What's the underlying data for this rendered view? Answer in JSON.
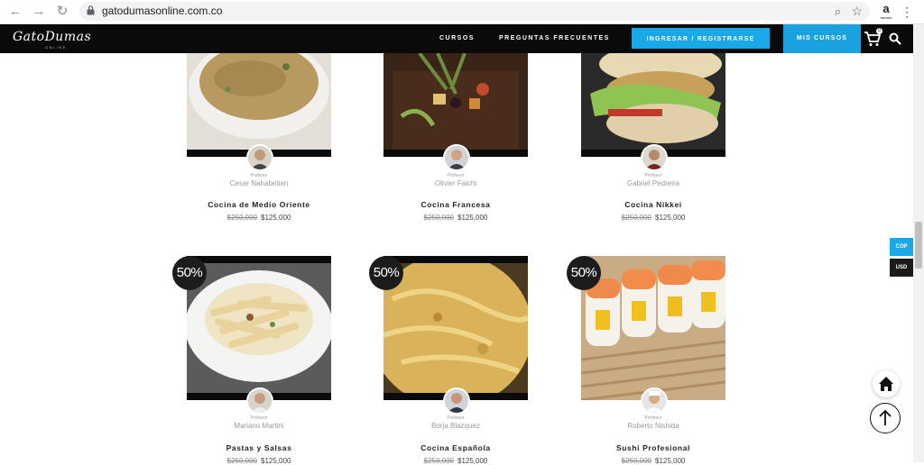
{
  "browser": {
    "url": "gatodumasonline.com.co",
    "ext_letter": "a",
    "ext_caption": "hmmm"
  },
  "header": {
    "logo_text": "GatoDumas",
    "logo_sub": "ONLINE",
    "nav_courses": "CURSOS",
    "nav_faq": "PREGUNTAS FRECUENTES",
    "login_button": "INGRESAR / REGISTRARSE",
    "my_courses_button": "MIS CURSOS",
    "cart_count": "0"
  },
  "currency": {
    "cop": "COP",
    "usd": "USD"
  },
  "colors": {
    "accent": "#1aa8e8",
    "header_bg": "#0a0a0a",
    "badge_bg": "#1c1c1c"
  },
  "courses_row1": [
    {
      "professor_label": "Profesor",
      "professor": "Cesar Nahabetian",
      "title": "Cocina de Medio Oriente",
      "old_price": "$250,000",
      "price": "$125,000"
    },
    {
      "professor_label": "Profesor",
      "professor": "Olivier Falchi",
      "title": "Cocina Francesa",
      "old_price": "$250,000",
      "price": "$125,000"
    },
    {
      "professor_label": "Profesor",
      "professor": "Gabriel Pedreira",
      "title": "Cocina Nikkei",
      "old_price": "$250,000",
      "price": "$125,000"
    }
  ],
  "courses_row2": [
    {
      "badge": "50%",
      "professor_label": "Profesor",
      "professor": "Mariano Martini",
      "title": "Pastas y Salsas",
      "old_price": "$250,000",
      "price": "$125,000"
    },
    {
      "badge": "50%",
      "professor_label": "Profesor",
      "professor": "Borja Blazquez",
      "title": "Cocina Española",
      "old_price": "$250,000",
      "price": "$125,000"
    },
    {
      "badge": "50%",
      "professor_label": "Profesor",
      "professor": "Roberto Nishida",
      "title": "Sushi Profesional",
      "old_price": "$250,000",
      "price": "$125,000"
    }
  ]
}
